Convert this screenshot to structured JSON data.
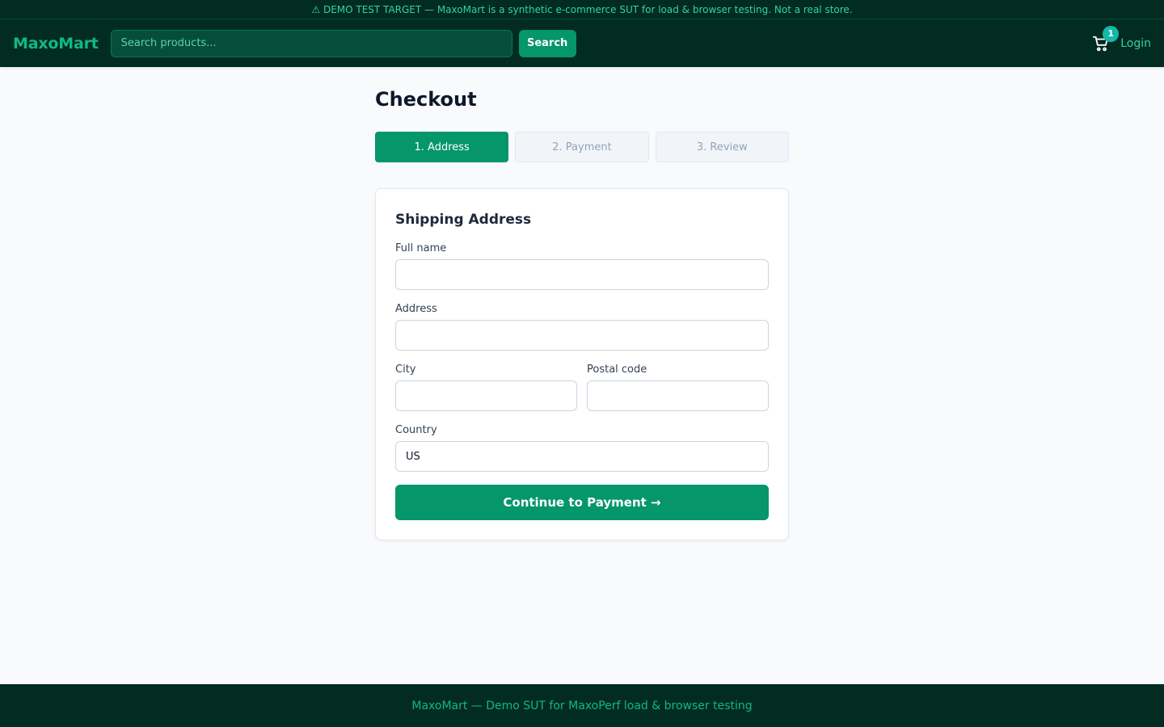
{
  "banner": {
    "text": "⚠ DEMO TEST TARGET — MaxoMart is a synthetic e-commerce SUT for load & browser testing. Not a real store."
  },
  "navbar": {
    "logo": "MaxoMart",
    "search_placeholder": "Search products...",
    "search_label": "Search",
    "cart_count": "1",
    "cart_icon": "cart-icon",
    "login_label": "Login"
  },
  "main": {
    "title": "Checkout",
    "steps": [
      {
        "label": "1. Address",
        "active": true
      },
      {
        "label": "2. Payment",
        "active": false
      },
      {
        "label": "3. Review",
        "active": false
      }
    ],
    "form": {
      "title": "Shipping Address",
      "full_name": {
        "label": "Full name",
        "value": ""
      },
      "address": {
        "label": "Address",
        "value": ""
      },
      "city": {
        "label": "City",
        "value": ""
      },
      "postal_code": {
        "label": "Postal code",
        "value": ""
      },
      "country": {
        "label": "Country",
        "value": "US"
      },
      "submit_label": "Continue to Payment →"
    }
  },
  "footer": {
    "text": "MaxoMart — Demo SUT for MaxoPerf load & browser testing"
  },
  "colors": {
    "accent": "#059669",
    "nav_bg": "#022c22",
    "logo": "#10b981",
    "badge": "#14b8a6"
  }
}
